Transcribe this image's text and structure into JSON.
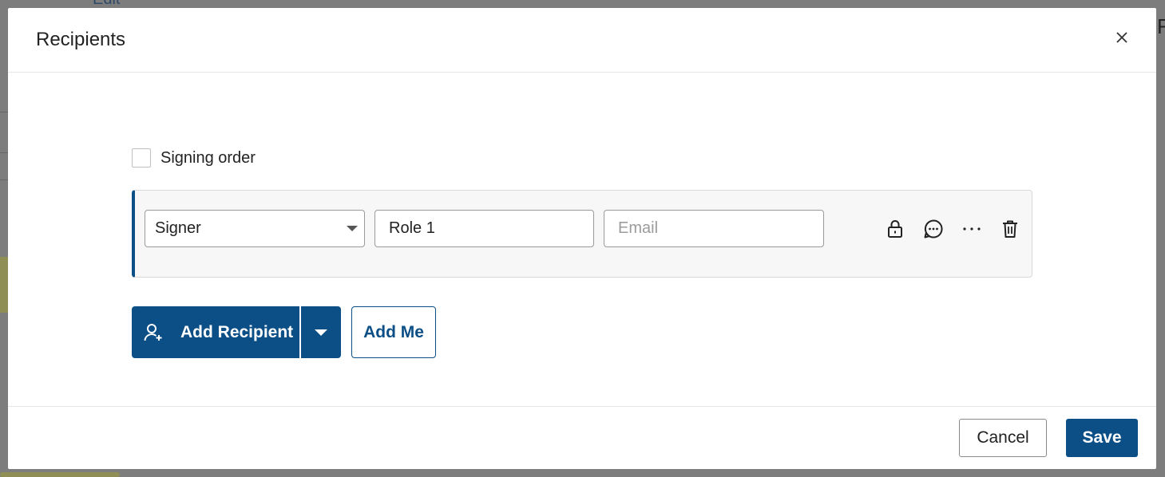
{
  "background": {
    "edit_text": "Edit",
    "right_text": "Fi"
  },
  "dialog": {
    "title": "Recipients",
    "signing_order_label": "Signing order",
    "signing_order_checked": false,
    "recipient": {
      "role_type": "Signer",
      "name_value": "Role 1",
      "email_placeholder": "Email",
      "icons": [
        "lock-icon",
        "comment-icon",
        "more-icon",
        "trash-icon"
      ]
    },
    "add_recipient_label": "Add Recipient",
    "add_me_label": "Add Me",
    "cancel_label": "Cancel",
    "save_label": "Save"
  },
  "colors": {
    "primary": "#0b4f86",
    "card_bg": "#f7f7f7",
    "placeholder": "#9b9b9b"
  }
}
